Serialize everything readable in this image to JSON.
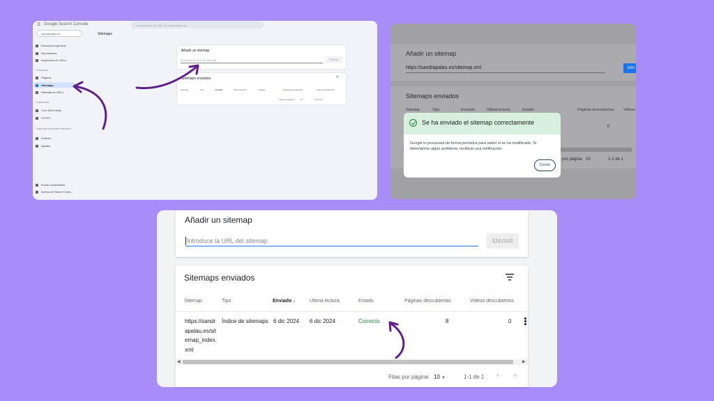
{
  "colors": {
    "background": "#a88cf8",
    "arrow": "#5f1e8c",
    "success_green": "#188038",
    "link_blue": "#1a73e8"
  },
  "panel1": {
    "app_title": "Google Search Console",
    "search_placeholder": "Inspeccionar las URL de sandrapalau.es",
    "property": "sandrapalau.es",
    "page_title": "Sitemaps",
    "nav": {
      "overview": "Descripción general",
      "performance": "Rendimiento",
      "url_inspection": "Inspección de URLs",
      "indexing_section": "Indexación",
      "pages": "Páginas",
      "sitemaps": "Sitemaps",
      "removals": "Retirada de URLs",
      "experience_section": "Experiencia",
      "cwv": "Core Web Vitals",
      "https": "HTTPS",
      "security_section": "Seguridad y acciones manuales",
      "links": "Enlaces",
      "settings": "Ajustes",
      "feedback": "Enviar comentarios",
      "about": "Acerca de Search Cons..."
    },
    "add_card": {
      "title": "Añadir un sitemap",
      "placeholder": "Introduce la URL del sitemap",
      "send": "ENVIAR"
    },
    "sent_card": {
      "title": "Sitemaps enviados",
      "columns": [
        "Sitemap",
        "Tipo",
        "Enviado",
        "Última lectura",
        "Estado",
        "Páginas descubiertas",
        "Vídeos descubiertos"
      ],
      "footer_rows_label": "Filas por página:",
      "footer_rows": "10",
      "footer_range": "0-0 de 0"
    }
  },
  "panel2": {
    "add_title": "Añadir un sitemap",
    "url_value": "https://sandrapalau.es/sitemap.xml",
    "send": "ENV",
    "sent_title": "Sitemaps enviados",
    "columns": [
      "Sitemap",
      "Tipo",
      "Enviado",
      "Última lectura",
      "Estado",
      "Páginas descubiertas",
      "Vídeos"
    ],
    "zero": "0",
    "footer_rows_label": "por página:",
    "footer_rows": "10",
    "footer_range": "1-1 de 1",
    "dialog": {
      "title": "Se ha enviado el sitemap correctamente",
      "body": "Google lo procesará de forma periódica para saber si se ha modificado. Si detectamos algún problema, recibirás una notificación.",
      "close": "Cerrar"
    }
  },
  "panel3": {
    "add_card": {
      "title": "Añadir un sitemap",
      "placeholder": "Introduce la URL del sitemap",
      "send": "ENVIAR"
    },
    "sent_card": {
      "title": "Sitemaps enviados",
      "headers": {
        "sitemap": "Sitemap",
        "type": "Tipo",
        "submitted": "Enviado",
        "last_read": "Última lectura",
        "status": "Estado",
        "pages": "Páginas descubiertas",
        "videos": "Videos descubiertos"
      },
      "row": {
        "sitemap": "https://sandrapalau.es/sitemap_index.xml",
        "type": "Índice de sitemaps",
        "submitted": "6 dic 2024",
        "last_read": "6 dic 2024",
        "status": "Correcto",
        "pages": "8",
        "videos": "0"
      },
      "footer": {
        "rows_label": "Filas por página:",
        "rows_value": "10",
        "range": "1-1 de 1"
      }
    }
  }
}
